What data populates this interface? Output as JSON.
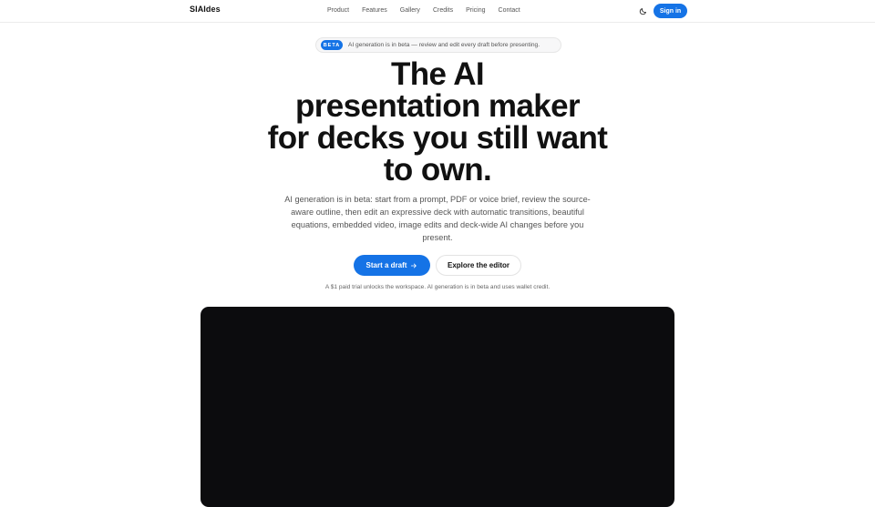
{
  "header": {
    "brand": "SlAIdes",
    "nav": [
      "Product",
      "Features",
      "Gallery",
      "Credits",
      "Pricing",
      "Contact"
    ],
    "theme_icon": "moon-icon",
    "sign_in": "Sign in"
  },
  "beta": {
    "badge": "BETA",
    "text": "AI generation is in beta — review and edit every draft before presenting."
  },
  "hero": {
    "title_lines": [
      "The AI",
      "presentation maker",
      "for decks you still want",
      "to own."
    ],
    "subtitle": "AI generation is in beta: start from a prompt, PDF or voice brief, review the source-aware outline, then edit an expressive deck with automatic transitions, beautiful equations, embedded video, image edits and deck-wide AI changes before you present.",
    "primary_cta": "Start a draft",
    "primary_cta_icon": "arrow-right-icon",
    "secondary_cta": "Explore the editor",
    "trial_note": "A $1 paid trial unlocks the workspace. AI generation is in beta and uses wallet credit."
  },
  "colors": {
    "accent": "#1573e6",
    "preview_bg": "#0c0c0e"
  }
}
